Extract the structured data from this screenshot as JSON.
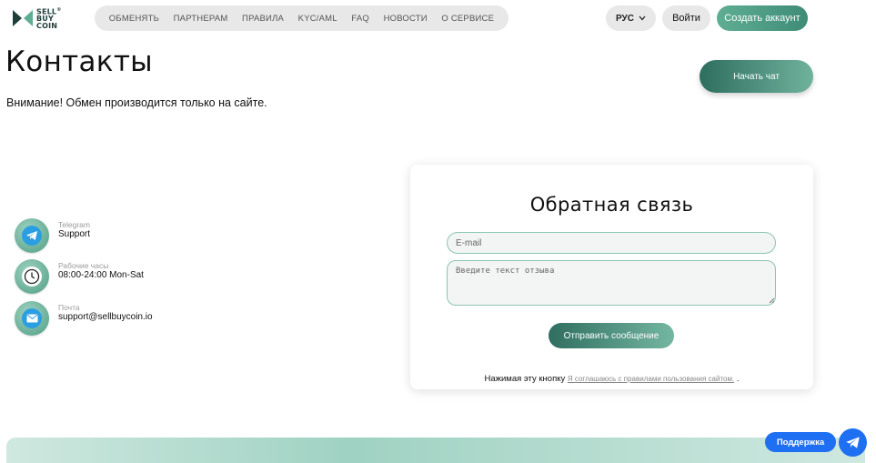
{
  "brand": {
    "line1": "SELL",
    "line2": "BUY",
    "line3": "COIN",
    "mark": "®"
  },
  "nav": {
    "items": [
      {
        "label": "ОБМЕНЯТЬ"
      },
      {
        "label": "ПАРТНЕРАМ"
      },
      {
        "label": "ПРАВИЛА"
      },
      {
        "label": "KYC/AML"
      },
      {
        "label": "FAQ"
      },
      {
        "label": "НОВОСТИ"
      },
      {
        "label": "О СЕРВИСЕ"
      }
    ]
  },
  "header": {
    "language": "РУС",
    "login_label": "Войти",
    "signup_label": "Создать аккаунт"
  },
  "main": {
    "title": "Контакты",
    "notice": "Внимание! Обмен производится только на сайте.",
    "chat_button": "Начать чат"
  },
  "contacts": [
    {
      "label": "Telegram",
      "value": "Support",
      "icon": "telegram-icon"
    },
    {
      "label": "Рабочие часы",
      "value": "08:00-24:00 Mon-Sat",
      "icon": "clock-icon"
    },
    {
      "label": "Почта",
      "value": "support@sellbuycoin.io",
      "icon": "mail-icon"
    }
  ],
  "feedback": {
    "title": "Обратная связь",
    "email_placeholder": "E-mail",
    "message_placeholder": "Введите текст отзыва",
    "send_label": "Отправить сообщение",
    "terms_prefix": "Нажимая эту кнопку",
    "terms_link": "Я соглашаюсь с правилами пользования сайтом.",
    "terms_suffix": "."
  },
  "support": {
    "label": "Поддержка",
    "icon": "telegram-icon"
  },
  "colors": {
    "accent": "#4f9d85",
    "support_blue": "#1e6ff2",
    "nav_bg": "#e8e8e8"
  }
}
